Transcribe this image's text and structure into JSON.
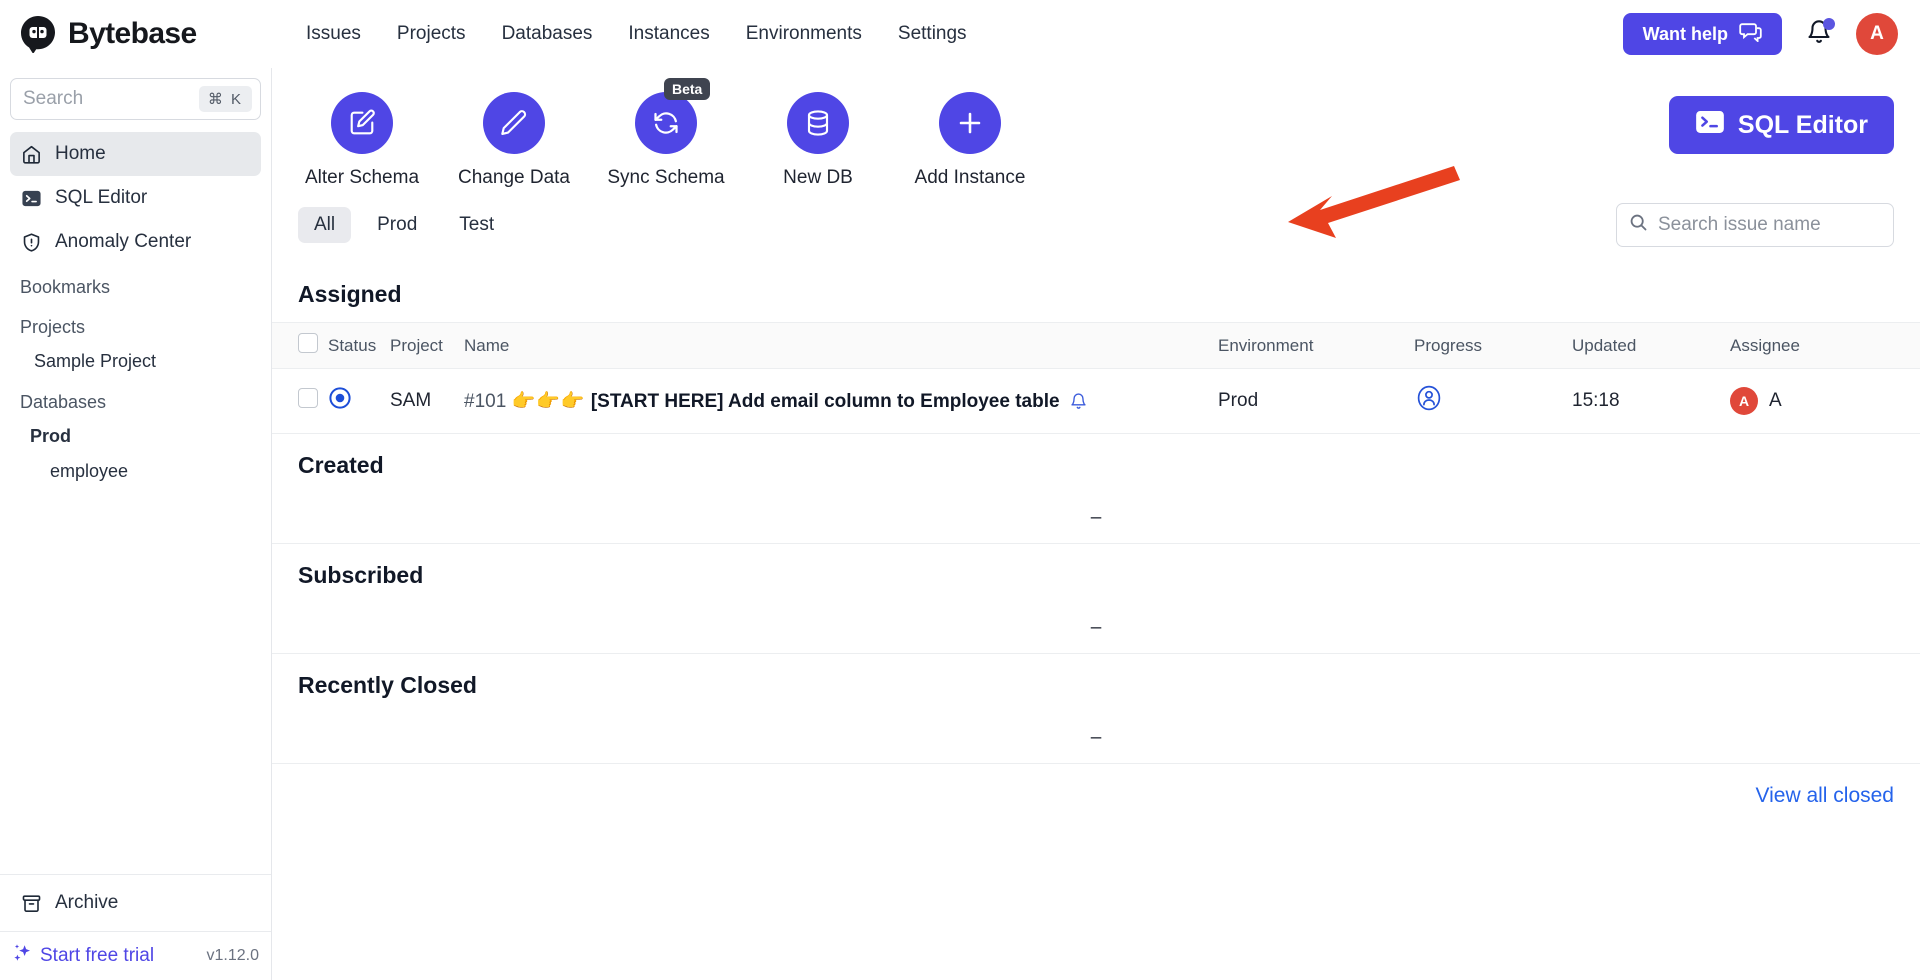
{
  "brand": {
    "name": "Bytebase"
  },
  "topnav": {
    "items": [
      {
        "label": "Issues"
      },
      {
        "label": "Projects"
      },
      {
        "label": "Databases"
      },
      {
        "label": "Instances"
      },
      {
        "label": "Environments"
      },
      {
        "label": "Settings"
      }
    ],
    "want_help": "Want help",
    "avatar_initial": "A"
  },
  "sidebar": {
    "search_placeholder": "Search",
    "search_shortcut": "⌘ K",
    "nav": [
      {
        "label": "Home",
        "icon": "home-icon",
        "active": true
      },
      {
        "label": "SQL Editor",
        "icon": "terminal-icon",
        "active": false
      },
      {
        "label": "Anomaly Center",
        "icon": "shield-alert-icon",
        "active": false
      }
    ],
    "bookmarks_label": "Bookmarks",
    "projects_label": "Projects",
    "projects": [
      {
        "label": "Sample Project"
      }
    ],
    "databases_label": "Databases",
    "databases": [
      {
        "label": "Prod",
        "bold": true
      },
      {
        "label": "employee",
        "bold": false
      }
    ],
    "archive_label": "Archive",
    "trial_label": "Start free trial",
    "version": "v1.12.0"
  },
  "quick_actions": [
    {
      "label": "Alter Schema",
      "icon": "edit-square-icon",
      "badge": ""
    },
    {
      "label": "Change Data",
      "icon": "pencil-icon",
      "badge": ""
    },
    {
      "label": "Sync Schema",
      "icon": "sync-icon",
      "badge": "Beta"
    },
    {
      "label": "New DB",
      "icon": "database-icon",
      "badge": ""
    },
    {
      "label": "Add Instance",
      "icon": "plus-icon",
      "badge": ""
    }
  ],
  "sql_editor_button": "SQL Editor",
  "filters": {
    "tabs": [
      {
        "label": "All",
        "active": true
      },
      {
        "label": "Prod",
        "active": false
      },
      {
        "label": "Test",
        "active": false
      }
    ],
    "search_placeholder": "Search issue name"
  },
  "table": {
    "headers": {
      "status": "Status",
      "project": "Project",
      "name": "Name",
      "environment": "Environment",
      "progress": "Progress",
      "updated": "Updated",
      "assignee": "Assignee"
    }
  },
  "sections": {
    "assigned": {
      "title": "Assigned",
      "rows": [
        {
          "project": "SAM",
          "number": "#101",
          "emoji": "👉👉👉",
          "name": "[START HERE] Add email column to Employee table",
          "environment": "Prod",
          "updated": "15:18",
          "assignee_initial": "A",
          "assignee_name": "A"
        }
      ]
    },
    "created": {
      "title": "Created",
      "empty_text": "–"
    },
    "subscribed": {
      "title": "Subscribed",
      "empty_text": "–"
    },
    "recently_closed": {
      "title": "Recently Closed",
      "empty_text": "–"
    }
  },
  "view_all_closed": "View all closed",
  "colors": {
    "accent": "#4f46e5",
    "avatar": "#e0483a",
    "link": "#2563eb",
    "annotation_arrow": "#e8401f",
    "status_blue": "#1d4ed8"
  }
}
